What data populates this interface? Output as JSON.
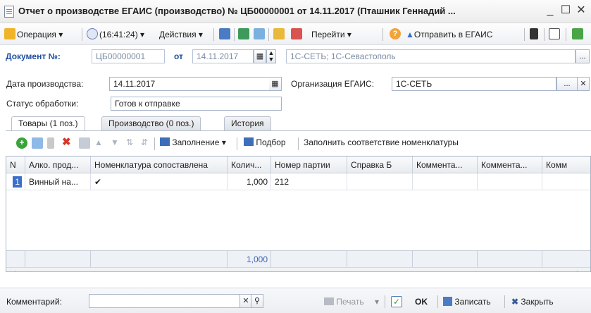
{
  "window": {
    "title": "Отчет о производстве ЕГАИС (производство) № ЦБ00000001 от 14.11.2017 (Пташник Геннадий ...",
    "minimize": "_",
    "maximize": "☐",
    "close": "✕"
  },
  "toolbar": {
    "operation": "Операция",
    "time": "(16:41:24)",
    "actions": "Действия",
    "goto": "Перейти",
    "help": "?",
    "send": "Отправить в ЕГАИС"
  },
  "header": {
    "doc_label": "Документ №:",
    "doc_number": "ЦБ00000001",
    "from_label": "от",
    "doc_date": "14.11.2017",
    "org_display": "1С-СЕТЬ; 1С-Севастополь",
    "ellipsis": "..."
  },
  "form": {
    "prod_date_label": "Дата производства:",
    "prod_date": "14.11.2017",
    "org_egais_label": "Организация ЕГАИС:",
    "org_egais": "1С-СЕТЬ",
    "status_label": "Статус обработки:",
    "status": "Готов к отправке"
  },
  "tabs": [
    {
      "label": "Товары (1 поз.)"
    },
    {
      "label": "Производство (0 поз.)"
    },
    {
      "label": "История"
    }
  ],
  "table_toolbar": {
    "fill": "Заполнение",
    "pick": "Подбор",
    "match": "Заполнить соответствие номенклатуры"
  },
  "grid": {
    "columns": [
      "N",
      "Алко. прод...",
      "Номенклатура сопоставлена",
      "Колич...",
      "Номер партии",
      "Справка Б",
      "Коммента...",
      "Коммента...",
      "Комм"
    ],
    "rows": [
      {
        "n": "1",
        "alco": "Винный на...",
        "matched": "✔",
        "qty": "1,000",
        "batch": "212"
      }
    ],
    "footer_total": "1,000"
  },
  "bottom": {
    "comment_label": "Комментарий:",
    "comment_value": "",
    "print": "Печать",
    "ok": "OK",
    "save": "Записать",
    "close": "Закрыть"
  },
  "colors": {
    "accent_blue": "#1f4e9d",
    "field_border": "#a7b4c8",
    "add_green": "#3aa33a",
    "delete_red": "#d33a2c"
  }
}
